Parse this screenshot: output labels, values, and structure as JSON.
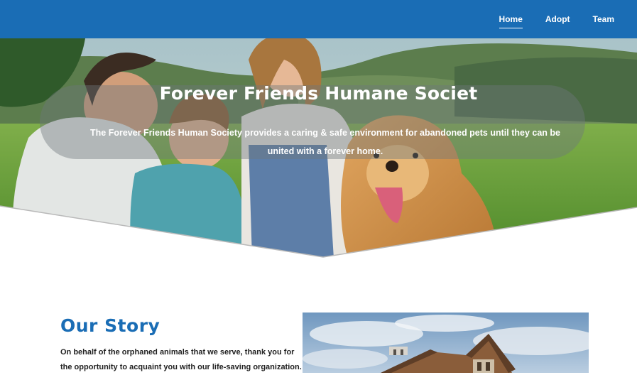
{
  "nav": {
    "items": [
      {
        "label": "Home",
        "active": true
      },
      {
        "label": "Adopt",
        "active": false
      },
      {
        "label": "Team",
        "active": false
      }
    ],
    "background_color": "#1a6db5"
  },
  "hero": {
    "title": "Forever Friends Humane Societ",
    "subtitle": "The Forever Friends Human Society provides a caring & safe environment for abandoned pets until they can be united with a forever home."
  },
  "story": {
    "heading": "Our Story",
    "text": "On behalf of the orphaned animals that we serve, thank you for the opportunity to acquaint you with our life-saving organization."
  },
  "colors": {
    "accent": "#1a6db5"
  }
}
